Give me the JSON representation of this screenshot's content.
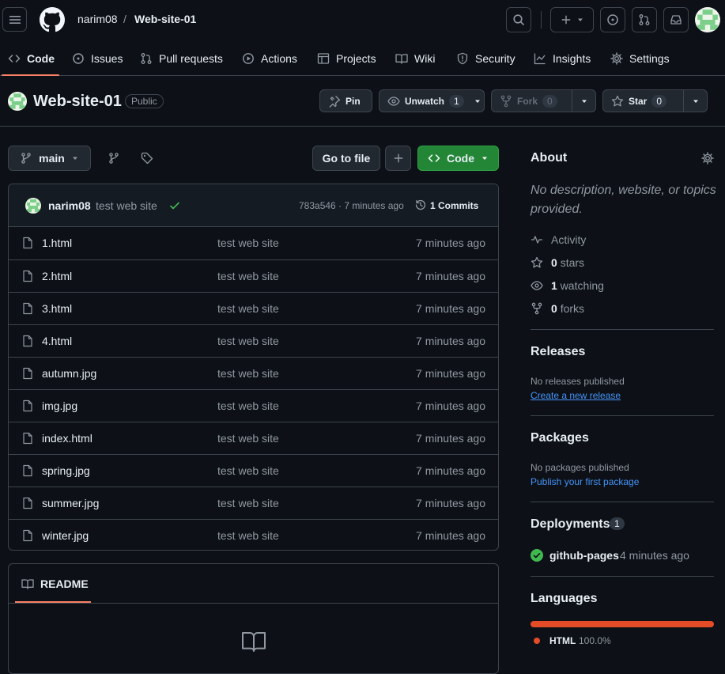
{
  "header": {
    "owner": "narim08",
    "separator": "/",
    "repo": "Web-site-01"
  },
  "tabs": [
    {
      "label": "Code",
      "icon": "code-icon"
    },
    {
      "label": "Issues",
      "icon": "issue-icon"
    },
    {
      "label": "Pull requests",
      "icon": "pull-request-icon"
    },
    {
      "label": "Actions",
      "icon": "play-icon"
    },
    {
      "label": "Projects",
      "icon": "table-icon"
    },
    {
      "label": "Wiki",
      "icon": "book-icon"
    },
    {
      "label": "Security",
      "icon": "shield-icon"
    },
    {
      "label": "Insights",
      "icon": "graph-icon"
    },
    {
      "label": "Settings",
      "icon": "gear-icon"
    }
  ],
  "repo": {
    "name": "Web-site-01",
    "visibility": "Public",
    "pin_label": "Pin",
    "unwatch_label": "Unwatch",
    "watch_count": "1",
    "fork_label": "Fork",
    "fork_count": "0",
    "star_label": "Star",
    "star_count": "0"
  },
  "branch": {
    "name": "main",
    "goto_file": "Go to file",
    "code_label": "Code"
  },
  "commit": {
    "author": "narim08",
    "message": "test web site",
    "hash_time": "783a546 · 7 minutes ago",
    "commits_label": "1 Commits"
  },
  "files": [
    {
      "name": "1.html",
      "message": "test web site",
      "time": "7 minutes ago"
    },
    {
      "name": "2.html",
      "message": "test web site",
      "time": "7 minutes ago"
    },
    {
      "name": "3.html",
      "message": "test web site",
      "time": "7 minutes ago"
    },
    {
      "name": "4.html",
      "message": "test web site",
      "time": "7 minutes ago"
    },
    {
      "name": "autumn.jpg",
      "message": "test web site",
      "time": "7 minutes ago"
    },
    {
      "name": "img.jpg",
      "message": "test web site",
      "time": "7 minutes ago"
    },
    {
      "name": "index.html",
      "message": "test web site",
      "time": "7 minutes ago"
    },
    {
      "name": "spring.jpg",
      "message": "test web site",
      "time": "7 minutes ago"
    },
    {
      "name": "summer.jpg",
      "message": "test web site",
      "time": "7 minutes ago"
    },
    {
      "name": "winter.jpg",
      "message": "test web site",
      "time": "7 minutes ago"
    }
  ],
  "readme": {
    "tab_label": "README"
  },
  "about": {
    "title": "About",
    "description": "No description, website, or topics provided.",
    "activity": "Activity",
    "stars_count": "0",
    "stars_label": "stars",
    "watching_count": "1",
    "watching_label": "watching",
    "forks_count": "0",
    "forks_label": "forks"
  },
  "releases": {
    "title": "Releases",
    "none": "No releases published",
    "create_link": "Create a new release"
  },
  "packages": {
    "title": "Packages",
    "none": "No packages published",
    "publish_link": "Publish your first package"
  },
  "deployments": {
    "title": "Deployments",
    "count": "1",
    "env": "github-pages",
    "time": "4 minutes ago"
  },
  "languages": {
    "title": "Languages",
    "items": [
      {
        "name": "HTML",
        "percent": "100.0%",
        "fraction": 1.0,
        "color": "#e34c26"
      }
    ]
  },
  "colors": {
    "background": "#0d1117",
    "border": "#3d444d",
    "accent_green": "#238636",
    "link_blue": "#4493f8",
    "tab_underline": "#f78166"
  }
}
